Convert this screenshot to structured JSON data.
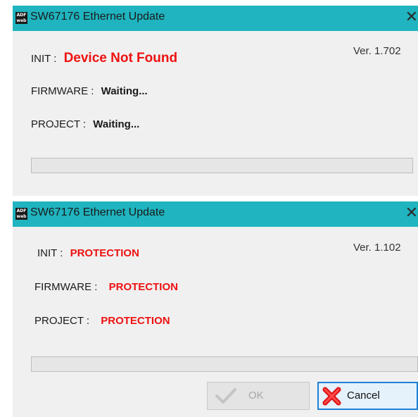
{
  "window1": {
    "title": "SW67176 Ethernet Update",
    "icon_text_top": "ADF",
    "icon_text_bottom": "web",
    "close_glyph": "✕",
    "version": "Ver. 1.702",
    "init_label": "INIT :",
    "init_value": "Device Not Found",
    "firmware_label": "FIRMWARE :",
    "firmware_value": "Waiting...",
    "project_label": "PROJECT :",
    "project_value": "Waiting...",
    "progress": 0
  },
  "window2": {
    "title": "SW67176 Ethernet Update",
    "icon_text_top": "ADF",
    "icon_text_bottom": "web",
    "close_glyph": "✕",
    "version": "Ver. 1.102",
    "init_label": "INIT :",
    "init_value": "PROTECTION",
    "firmware_label": "FIRMWARE :",
    "firmware_value": "PROTECTION",
    "project_label": "PROJECT :",
    "project_value": "PROTECTION",
    "progress": 0,
    "ok_label": "OK",
    "cancel_label": "Cancel"
  },
  "icons": [
    "app-icon",
    "close-icon",
    "checkmark-icon",
    "red-x-icon"
  ],
  "colors": {
    "titlebar": "#1fb4bf",
    "error_text": "#ee1111",
    "cancel_border": "#1c7fd6"
  }
}
